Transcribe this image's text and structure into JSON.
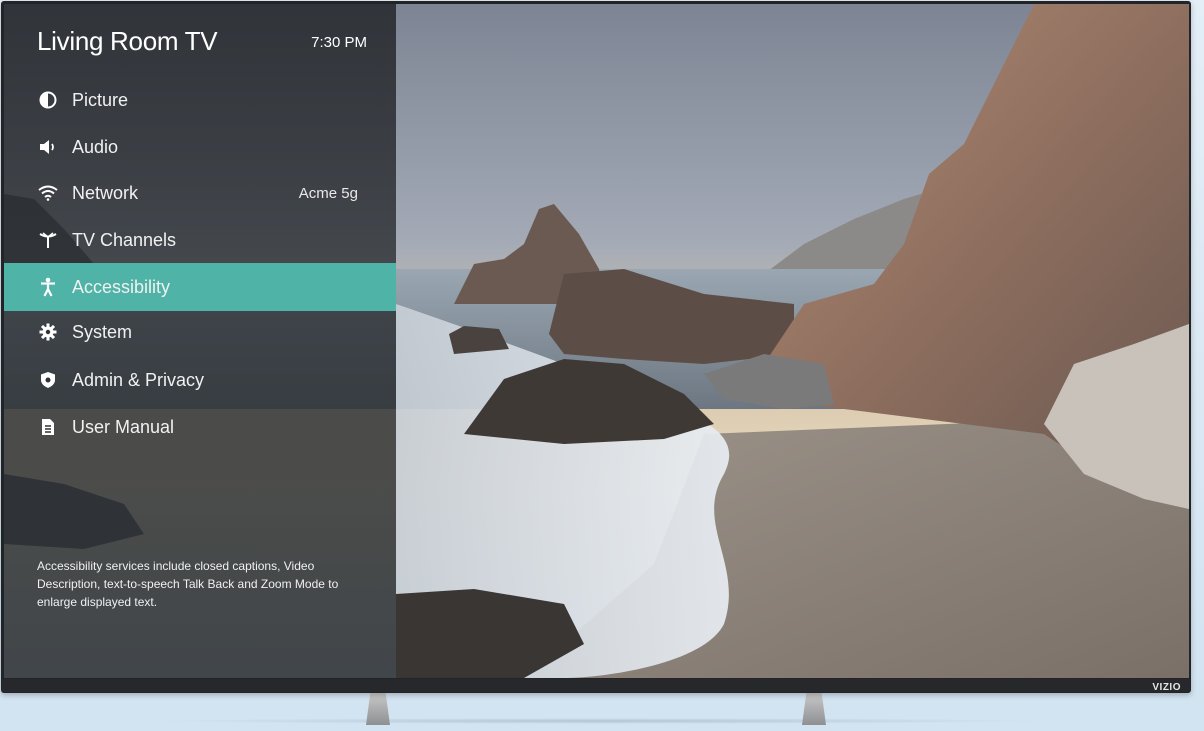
{
  "header": {
    "tv_name": "Living Room TV",
    "time": "7:30 PM"
  },
  "menu": [
    {
      "label": "Picture",
      "icon": "contrast-icon",
      "value": ""
    },
    {
      "label": "Audio",
      "icon": "speaker-icon",
      "value": ""
    },
    {
      "label": "Network",
      "icon": "wifi-icon",
      "value": "Acme 5g"
    },
    {
      "label": "TV Channels",
      "icon": "antenna-icon",
      "value": ""
    },
    {
      "label": "Accessibility",
      "icon": "accessibility-icon",
      "value": "",
      "selected": true
    },
    {
      "label": "System",
      "icon": "gear-icon",
      "value": ""
    },
    {
      "label": "Admin & Privacy",
      "icon": "shield-icon",
      "value": ""
    },
    {
      "label": "User Manual",
      "icon": "document-icon",
      "value": ""
    }
  ],
  "description": "Accessibility services include closed captions, Video Description, text-to-speech Talk Back and Zoom Mode to enlarge displayed text.",
  "brand": "VIZIO",
  "colors": {
    "selected": "#4fb3a7",
    "panel": "#2a2d31"
  }
}
